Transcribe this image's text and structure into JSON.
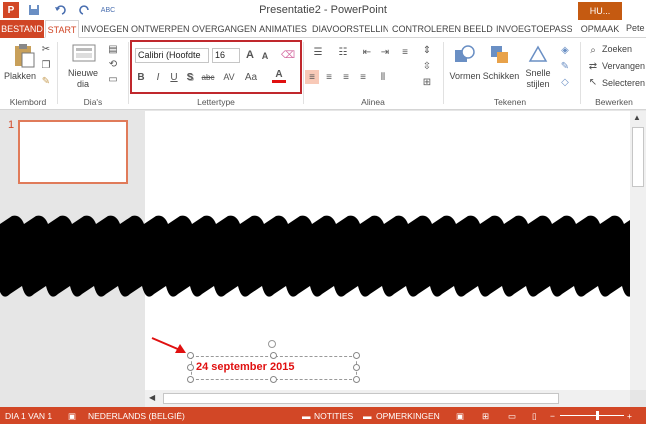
{
  "window": {
    "title": "Presentatie2 - PowerPoint"
  },
  "qat": {
    "app_icon": "P",
    "save_icon": "save-icon",
    "undo_icon": "undo-icon",
    "redo_icon": "redo-icon",
    "spell_icon": "ABC"
  },
  "account": {
    "user_badge": "HU...",
    "user_name": "Pete"
  },
  "tabs": [
    "BESTAND",
    "START",
    "INVOEGEN",
    "ONTWERPEN",
    "OVERGANGEN",
    "ANIMATIES",
    "DIAVOORSTELLIN",
    "CONTROLEREN",
    "BEELD",
    "INVOEGTOEPASSI",
    "OPMAAK"
  ],
  "ribbon": {
    "clipboard": {
      "paste": "Plakken",
      "label": "Klembord"
    },
    "slides": {
      "new_slide": "Nieuwe",
      "new_slide2": "dia",
      "label": "Dia's"
    },
    "font": {
      "name": "Calibri (Hoofdte",
      "size": "16",
      "label": "Lettertype",
      "bold": "B",
      "italic": "I",
      "underline": "U",
      "shadow": "S",
      "strike": "abc",
      "spacing": "AV",
      "case": "Aa",
      "color": "A",
      "grow": "A",
      "shrink": "A"
    },
    "paragraph": {
      "label": "Alinea"
    },
    "drawing": {
      "shapes": "Vormen",
      "arrange": "Schikken",
      "quick1": "Snelle",
      "quick2": "stijlen",
      "label": "Tekenen"
    },
    "editing": {
      "find": "Zoeken",
      "replace": "Vervangen",
      "select": "Selecteren",
      "label": "Bewerken"
    }
  },
  "thumbnail": {
    "number": "1"
  },
  "textbox": {
    "value": "24 september 2015"
  },
  "status": {
    "slide": "DIA 1 VAN 1",
    "language": "NEDERLANDS (BELGIË)",
    "notes": "NOTITIES",
    "comments": "OPMERKINGEN"
  },
  "colors": {
    "accent": "#d24726",
    "annotation": "#c0282d"
  }
}
